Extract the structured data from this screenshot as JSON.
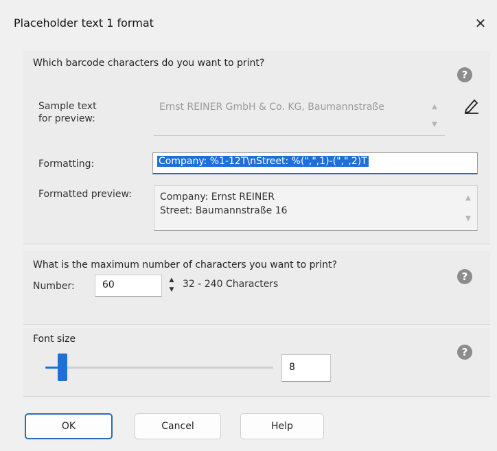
{
  "window": {
    "title": "Placeholder text 1 format",
    "close_glyph": "✕"
  },
  "section_characters": {
    "title": "Which barcode characters do you want to print?",
    "help_glyph": "?",
    "sample_label": "Sample text\nfor preview:",
    "sample_text": "Ernst REINER GmbH & Co. KG, Baumannstraße",
    "formatting_label": "Formatting:",
    "formatting_value": "Company: %1-12T\\nStreet: %(\",\",1)-(\",\",2)T",
    "preview_label": "Formatted preview:",
    "preview_lines": [
      "Company: Ernst REINER",
      "Street: Baumannstraße 16"
    ]
  },
  "section_maximum": {
    "title": "What is the maximum number of characters you want to print?",
    "help_glyph": "?",
    "number_label": "Number:",
    "number_value": "60",
    "range_text": "32 - 240 Characters"
  },
  "section_font": {
    "title": "Font size",
    "help_glyph": "?",
    "value": "8"
  },
  "buttons": {
    "ok": "OK",
    "cancel": "Cancel",
    "help": "Help"
  },
  "colors": {
    "accent": "#1e6fd9",
    "help_icon": "#8c8c8c"
  }
}
